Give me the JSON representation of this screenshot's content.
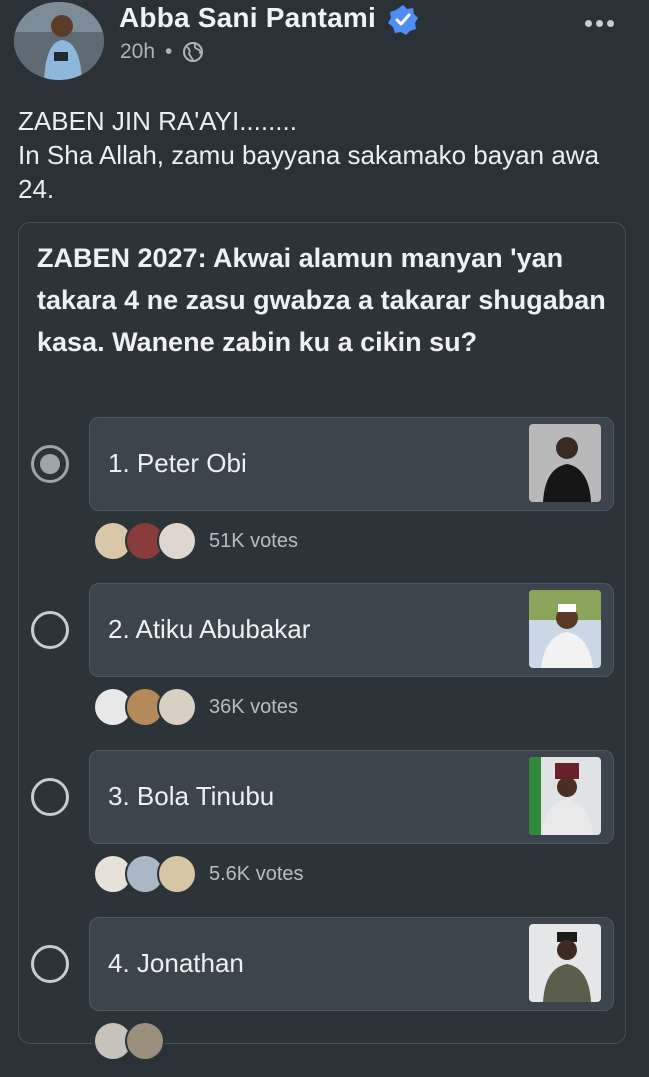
{
  "post": {
    "author": "Abba Sani Pantami",
    "time": "20h",
    "text": "ZABEN JIN RA'AYI........\nIn Sha Allah, zamu bayyana sakamako bayan awa 24."
  },
  "icons": {
    "verified": "verified-badge-icon",
    "audience": "globe-icon",
    "more": "more-options-icon"
  },
  "poll": {
    "question": "ZABEN 2027: Akwai alamun manyan 'yan takara 4 ne zasu gwabza a takarar shugaban kasa. Wanene zabin ku a cikin su?",
    "options": [
      {
        "label": "1. Peter Obi",
        "votes": "51K votes",
        "selected": true
      },
      {
        "label": "2. Atiku Abubakar",
        "votes": "36K votes",
        "selected": false
      },
      {
        "label": "3. Bola Tinubu",
        "votes": "5.6K votes",
        "selected": false
      },
      {
        "label": "4. Jonathan",
        "votes": "",
        "selected": false
      }
    ]
  },
  "colors": {
    "background": "#2a3238",
    "verified": "#4f8ef7",
    "option_fill": "#3c454d"
  }
}
